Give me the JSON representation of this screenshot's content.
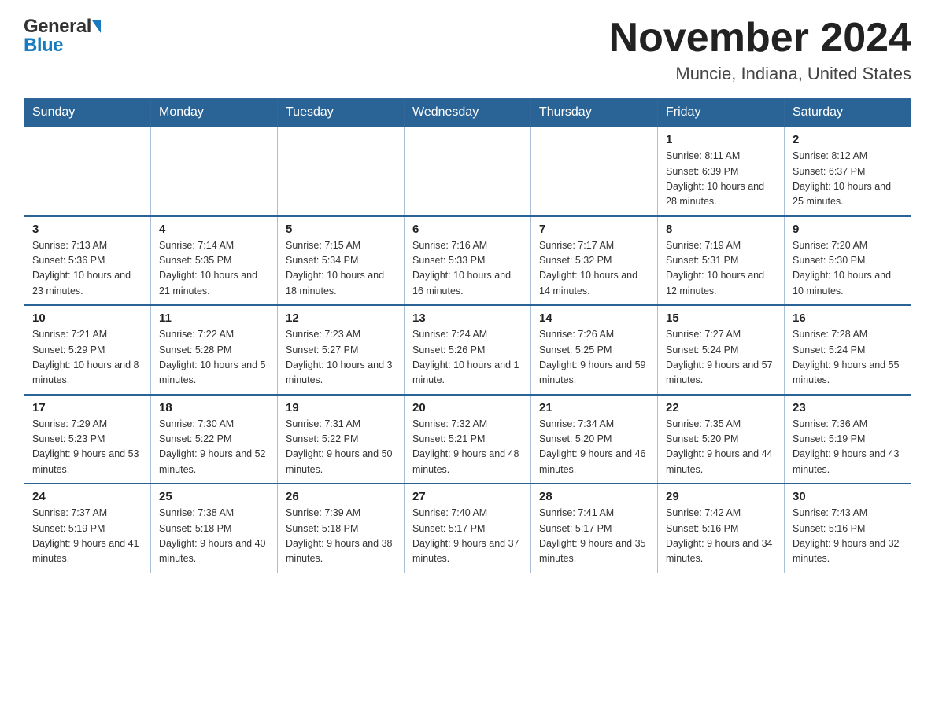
{
  "logo": {
    "general": "General",
    "blue": "Blue",
    "triangle_alt": "logo triangle"
  },
  "title": "November 2024",
  "subtitle": "Muncie, Indiana, United States",
  "days_of_week": [
    "Sunday",
    "Monday",
    "Tuesday",
    "Wednesday",
    "Thursday",
    "Friday",
    "Saturday"
  ],
  "weeks": [
    [
      {
        "day": "",
        "info": ""
      },
      {
        "day": "",
        "info": ""
      },
      {
        "day": "",
        "info": ""
      },
      {
        "day": "",
        "info": ""
      },
      {
        "day": "",
        "info": ""
      },
      {
        "day": "1",
        "info": "Sunrise: 8:11 AM\nSunset: 6:39 PM\nDaylight: 10 hours and 28 minutes."
      },
      {
        "day": "2",
        "info": "Sunrise: 8:12 AM\nSunset: 6:37 PM\nDaylight: 10 hours and 25 minutes."
      }
    ],
    [
      {
        "day": "3",
        "info": "Sunrise: 7:13 AM\nSunset: 5:36 PM\nDaylight: 10 hours and 23 minutes."
      },
      {
        "day": "4",
        "info": "Sunrise: 7:14 AM\nSunset: 5:35 PM\nDaylight: 10 hours and 21 minutes."
      },
      {
        "day": "5",
        "info": "Sunrise: 7:15 AM\nSunset: 5:34 PM\nDaylight: 10 hours and 18 minutes."
      },
      {
        "day": "6",
        "info": "Sunrise: 7:16 AM\nSunset: 5:33 PM\nDaylight: 10 hours and 16 minutes."
      },
      {
        "day": "7",
        "info": "Sunrise: 7:17 AM\nSunset: 5:32 PM\nDaylight: 10 hours and 14 minutes."
      },
      {
        "day": "8",
        "info": "Sunrise: 7:19 AM\nSunset: 5:31 PM\nDaylight: 10 hours and 12 minutes."
      },
      {
        "day": "9",
        "info": "Sunrise: 7:20 AM\nSunset: 5:30 PM\nDaylight: 10 hours and 10 minutes."
      }
    ],
    [
      {
        "day": "10",
        "info": "Sunrise: 7:21 AM\nSunset: 5:29 PM\nDaylight: 10 hours and 8 minutes."
      },
      {
        "day": "11",
        "info": "Sunrise: 7:22 AM\nSunset: 5:28 PM\nDaylight: 10 hours and 5 minutes."
      },
      {
        "day": "12",
        "info": "Sunrise: 7:23 AM\nSunset: 5:27 PM\nDaylight: 10 hours and 3 minutes."
      },
      {
        "day": "13",
        "info": "Sunrise: 7:24 AM\nSunset: 5:26 PM\nDaylight: 10 hours and 1 minute."
      },
      {
        "day": "14",
        "info": "Sunrise: 7:26 AM\nSunset: 5:25 PM\nDaylight: 9 hours and 59 minutes."
      },
      {
        "day": "15",
        "info": "Sunrise: 7:27 AM\nSunset: 5:24 PM\nDaylight: 9 hours and 57 minutes."
      },
      {
        "day": "16",
        "info": "Sunrise: 7:28 AM\nSunset: 5:24 PM\nDaylight: 9 hours and 55 minutes."
      }
    ],
    [
      {
        "day": "17",
        "info": "Sunrise: 7:29 AM\nSunset: 5:23 PM\nDaylight: 9 hours and 53 minutes."
      },
      {
        "day": "18",
        "info": "Sunrise: 7:30 AM\nSunset: 5:22 PM\nDaylight: 9 hours and 52 minutes."
      },
      {
        "day": "19",
        "info": "Sunrise: 7:31 AM\nSunset: 5:22 PM\nDaylight: 9 hours and 50 minutes."
      },
      {
        "day": "20",
        "info": "Sunrise: 7:32 AM\nSunset: 5:21 PM\nDaylight: 9 hours and 48 minutes."
      },
      {
        "day": "21",
        "info": "Sunrise: 7:34 AM\nSunset: 5:20 PM\nDaylight: 9 hours and 46 minutes."
      },
      {
        "day": "22",
        "info": "Sunrise: 7:35 AM\nSunset: 5:20 PM\nDaylight: 9 hours and 44 minutes."
      },
      {
        "day": "23",
        "info": "Sunrise: 7:36 AM\nSunset: 5:19 PM\nDaylight: 9 hours and 43 minutes."
      }
    ],
    [
      {
        "day": "24",
        "info": "Sunrise: 7:37 AM\nSunset: 5:19 PM\nDaylight: 9 hours and 41 minutes."
      },
      {
        "day": "25",
        "info": "Sunrise: 7:38 AM\nSunset: 5:18 PM\nDaylight: 9 hours and 40 minutes."
      },
      {
        "day": "26",
        "info": "Sunrise: 7:39 AM\nSunset: 5:18 PM\nDaylight: 9 hours and 38 minutes."
      },
      {
        "day": "27",
        "info": "Sunrise: 7:40 AM\nSunset: 5:17 PM\nDaylight: 9 hours and 37 minutes."
      },
      {
        "day": "28",
        "info": "Sunrise: 7:41 AM\nSunset: 5:17 PM\nDaylight: 9 hours and 35 minutes."
      },
      {
        "day": "29",
        "info": "Sunrise: 7:42 AM\nSunset: 5:16 PM\nDaylight: 9 hours and 34 minutes."
      },
      {
        "day": "30",
        "info": "Sunrise: 7:43 AM\nSunset: 5:16 PM\nDaylight: 9 hours and 32 minutes."
      }
    ]
  ],
  "colors": {
    "header_bg": "#2a6496",
    "header_text": "#ffffff",
    "border": "#336699",
    "accent_blue": "#1a7abf"
  }
}
